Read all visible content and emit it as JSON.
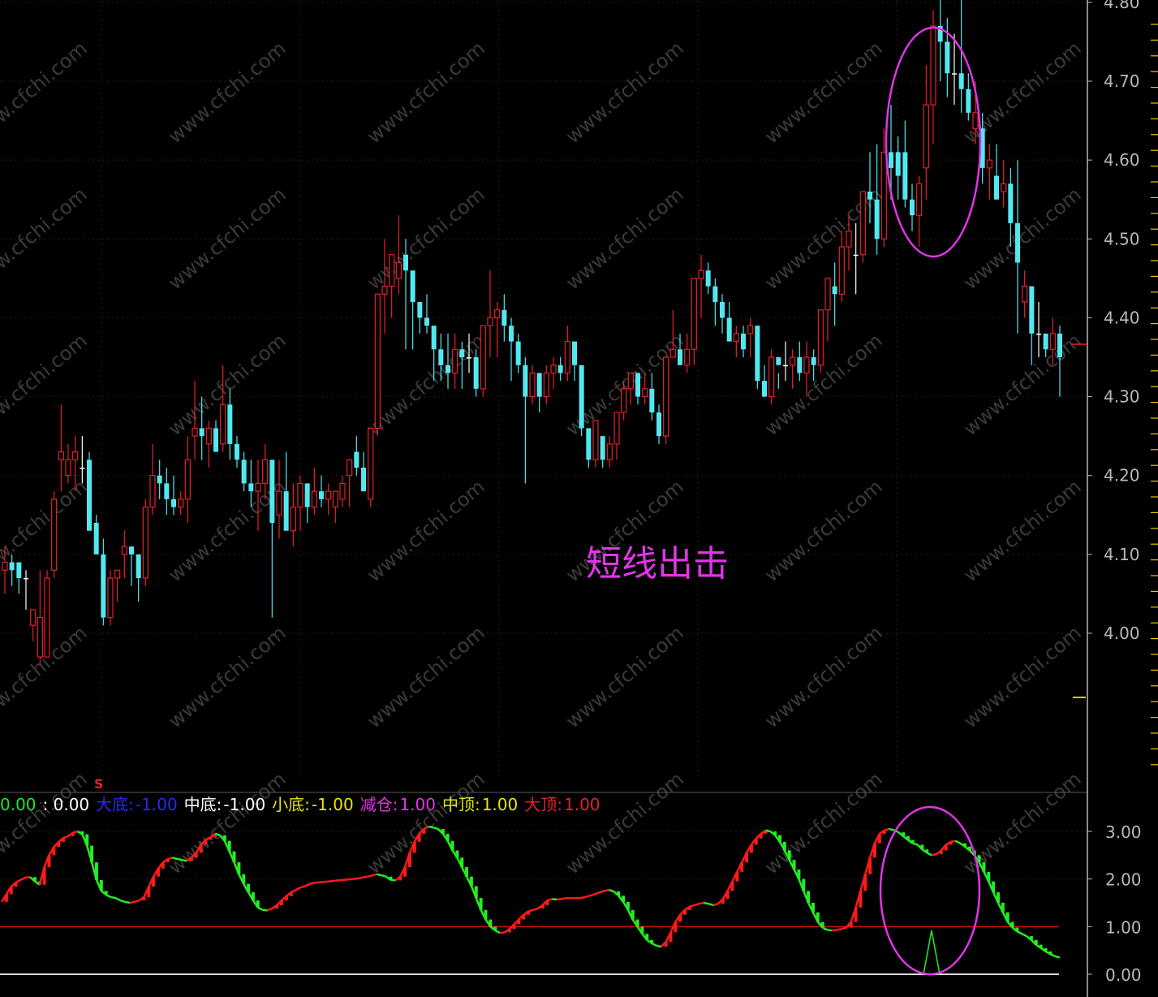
{
  "price_axis": [
    "4.80",
    "4.70",
    "4.60",
    "4.50",
    "4.40",
    "4.30",
    "4.20",
    "4.10",
    "4.00"
  ],
  "indicator_axis": [
    "3.00",
    "2.00",
    "1.00",
    "0.00"
  ],
  "watermark": "www.cfchi.com",
  "annotation": "短线出击",
  "signal_mark": "S",
  "indicator_legend": [
    {
      "text": "0.00",
      "color": "#1ee81e"
    },
    {
      "text": ": 0.00",
      "color": "#ffffff"
    },
    {
      "text": "大底:",
      "color": "#2828ff"
    },
    {
      "text": "-1.00",
      "color": "#2828ff"
    },
    {
      "text": "中底:",
      "color": "#ffffff"
    },
    {
      "text": "-1.00",
      "color": "#ffffff"
    },
    {
      "text": "小底:",
      "color": "#e6e600"
    },
    {
      "text": "-1.00",
      "color": "#e6e600"
    },
    {
      "text": "减仓:",
      "color": "#e035e6"
    },
    {
      "text": "1.00",
      "color": "#e035e6"
    },
    {
      "text": "中顶:",
      "color": "#e6e600"
    },
    {
      "text": "1.00",
      "color": "#e6e600"
    },
    {
      "text": "大顶:",
      "color": "#e8202a"
    },
    {
      "text": "1.00",
      "color": "#e8202a"
    }
  ],
  "colors": {
    "up": "#e8202a",
    "down": "#52e8f0",
    "doji": "#ffffff",
    "ind_up": "#ff1a1a",
    "ind_down": "#22ee22",
    "circle": "#e035e6",
    "axis": "#b8b8b8",
    "ref_line": "#d01010",
    "yellow": "#e6c800"
  },
  "chart_data": [
    {
      "type": "candlestick",
      "title": "",
      "y_ticks": [
        4.0,
        4.1,
        4.2,
        4.3,
        4.4,
        4.5,
        4.6,
        4.7,
        4.8
      ],
      "ylim": [
        3.92,
        4.81
      ],
      "grid": true,
      "ohlc": [
        [
          4.08,
          4.11,
          4.05,
          4.09
        ],
        [
          4.09,
          4.1,
          4.06,
          4.08
        ],
        [
          4.09,
          4.08,
          4.05,
          4.07
        ],
        [
          4.07,
          4.08,
          4.03,
          4.07
        ],
        [
          4.01,
          4.03,
          3.99,
          4.03
        ],
        [
          3.97,
          4.08,
          3.96,
          4.02
        ],
        [
          3.97,
          4.08,
          3.97,
          4.07
        ],
        [
          4.08,
          4.18,
          4.07,
          4.17
        ],
        [
          4.22,
          4.29,
          4.18,
          4.23
        ],
        [
          4.2,
          4.24,
          4.19,
          4.22
        ],
        [
          4.22,
          4.25,
          4.18,
          4.23
        ],
        [
          4.21,
          4.25,
          4.19,
          4.21
        ],
        [
          4.22,
          4.23,
          4.15,
          4.13
        ],
        [
          4.14,
          4.15,
          4.1,
          4.1
        ],
        [
          4.1,
          4.12,
          4.01,
          4.02
        ],
        [
          4.02,
          4.08,
          4.01,
          4.07
        ],
        [
          4.07,
          4.08,
          4.04,
          4.08
        ],
        [
          4.1,
          4.13,
          4.07,
          4.11
        ],
        [
          4.11,
          4.1,
          4.06,
          4.1
        ],
        [
          4.1,
          4.1,
          4.04,
          4.07
        ],
        [
          4.07,
          4.17,
          4.06,
          4.16
        ],
        [
          4.16,
          4.24,
          4.15,
          4.2
        ],
        [
          4.2,
          4.22,
          4.17,
          4.19
        ],
        [
          4.19,
          4.21,
          4.15,
          4.17
        ],
        [
          4.17,
          4.2,
          4.15,
          4.16
        ],
        [
          4.16,
          4.18,
          4.15,
          4.17
        ],
        [
          4.17,
          4.25,
          4.14,
          4.22
        ],
        [
          4.25,
          4.32,
          4.22,
          4.26
        ],
        [
          4.26,
          4.3,
          4.22,
          4.25
        ],
        [
          4.24,
          4.27,
          4.21,
          4.26
        ],
        [
          4.26,
          4.27,
          4.23,
          4.23
        ],
        [
          4.24,
          4.34,
          4.23,
          4.29
        ],
        [
          4.29,
          4.31,
          4.22,
          4.24
        ],
        [
          4.24,
          4.25,
          4.21,
          4.22
        ],
        [
          4.22,
          4.23,
          4.18,
          4.19
        ],
        [
          4.19,
          4.22,
          4.16,
          4.18
        ],
        [
          4.18,
          4.22,
          4.13,
          4.19
        ],
        [
          4.19,
          4.24,
          4.17,
          4.22
        ],
        [
          4.22,
          4.2,
          4.02,
          4.14
        ],
        [
          4.15,
          4.22,
          4.12,
          4.18
        ],
        [
          4.18,
          4.23,
          4.14,
          4.13
        ],
        [
          4.13,
          4.19,
          4.11,
          4.16
        ],
        [
          4.16,
          4.2,
          4.13,
          4.19
        ],
        [
          4.19,
          4.19,
          4.14,
          4.16
        ],
        [
          4.16,
          4.21,
          4.15,
          4.18
        ],
        [
          4.18,
          4.2,
          4.16,
          4.17
        ],
        [
          4.17,
          4.19,
          4.15,
          4.18
        ],
        [
          4.16,
          4.18,
          4.14,
          4.18
        ],
        [
          4.17,
          4.2,
          4.16,
          4.19
        ],
        [
          4.2,
          4.22,
          4.16,
          4.22
        ],
        [
          4.23,
          4.25,
          4.2,
          4.21
        ],
        [
          4.21,
          4.23,
          4.18,
          4.18
        ],
        [
          4.17,
          4.26,
          4.16,
          4.26
        ],
        [
          4.26,
          4.42,
          4.25,
          4.43
        ],
        [
          4.43,
          4.5,
          4.38,
          4.44
        ],
        [
          4.44,
          4.48,
          4.4,
          4.48
        ],
        [
          4.45,
          4.53,
          4.43,
          4.47
        ],
        [
          4.48,
          4.5,
          4.36,
          4.46
        ],
        [
          4.46,
          4.45,
          4.36,
          4.42
        ],
        [
          4.42,
          4.42,
          4.38,
          4.4
        ],
        [
          4.4,
          4.43,
          4.38,
          4.39
        ],
        [
          4.39,
          4.38,
          4.32,
          4.36
        ],
        [
          4.36,
          4.38,
          4.32,
          4.34
        ],
        [
          4.34,
          4.38,
          4.31,
          4.33
        ],
        [
          4.33,
          4.38,
          4.31,
          4.36
        ],
        [
          4.36,
          4.37,
          4.31,
          4.35
        ],
        [
          4.35,
          4.38,
          4.33,
          4.35
        ],
        [
          4.35,
          4.36,
          4.3,
          4.31
        ],
        [
          4.31,
          4.39,
          4.3,
          4.39
        ],
        [
          4.39,
          4.46,
          4.35,
          4.4
        ],
        [
          4.4,
          4.42,
          4.35,
          4.41
        ],
        [
          4.41,
          4.43,
          4.37,
          4.39
        ],
        [
          4.39,
          4.4,
          4.32,
          4.37
        ],
        [
          4.37,
          4.38,
          4.33,
          4.34
        ],
        [
          4.34,
          4.35,
          4.19,
          4.3
        ],
        [
          4.3,
          4.34,
          4.29,
          4.33
        ],
        [
          4.33,
          4.31,
          4.28,
          4.3
        ],
        [
          4.3,
          4.34,
          4.29,
          4.33
        ],
        [
          4.33,
          4.35,
          4.31,
          4.34
        ],
        [
          4.34,
          4.35,
          4.32,
          4.33
        ],
        [
          4.33,
          4.39,
          4.32,
          4.37
        ],
        [
          4.37,
          4.36,
          4.32,
          4.34
        ],
        [
          4.34,
          4.31,
          4.25,
          4.26
        ],
        [
          4.26,
          4.24,
          4.21,
          4.22
        ],
        [
          4.22,
          4.26,
          4.21,
          4.27
        ],
        [
          4.25,
          4.23,
          4.21,
          4.22
        ],
        [
          4.22,
          4.25,
          4.21,
          4.24
        ],
        [
          4.24,
          4.28,
          4.22,
          4.28
        ],
        [
          4.28,
          4.32,
          4.27,
          4.31
        ],
        [
          4.31,
          4.33,
          4.29,
          4.33
        ],
        [
          4.33,
          4.33,
          4.29,
          4.3
        ],
        [
          4.3,
          4.33,
          4.29,
          4.31
        ],
        [
          4.31,
          4.33,
          4.27,
          4.28
        ],
        [
          4.28,
          4.29,
          4.24,
          4.25
        ],
        [
          4.25,
          4.34,
          4.24,
          4.35
        ],
        [
          4.35,
          4.41,
          4.35,
          4.36
        ],
        [
          4.36,
          4.38,
          4.34,
          4.34
        ],
        [
          4.34,
          4.38,
          4.33,
          4.36
        ],
        [
          4.36,
          4.42,
          4.34,
          4.45
        ],
        [
          4.45,
          4.48,
          4.4,
          4.46
        ],
        [
          4.46,
          4.47,
          4.43,
          4.44
        ],
        [
          4.44,
          4.45,
          4.39,
          4.42
        ],
        [
          4.42,
          4.43,
          4.38,
          4.4
        ],
        [
          4.4,
          4.42,
          4.37,
          4.37
        ],
        [
          4.37,
          4.39,
          4.35,
          4.38
        ],
        [
          4.38,
          4.39,
          4.35,
          4.36
        ],
        [
          4.38,
          4.4,
          4.35,
          4.39
        ],
        [
          4.39,
          4.38,
          4.31,
          4.32
        ],
        [
          4.32,
          4.34,
          4.3,
          4.3
        ],
        [
          4.3,
          4.36,
          4.29,
          4.35
        ],
        [
          4.35,
          4.33,
          4.31,
          4.34
        ],
        [
          4.34,
          4.37,
          4.32,
          4.34
        ],
        [
          4.34,
          4.36,
          4.31,
          4.35
        ],
        [
          4.35,
          4.37,
          4.32,
          4.33
        ],
        [
          4.33,
          4.37,
          4.3,
          4.35
        ],
        [
          4.35,
          4.36,
          4.32,
          4.34
        ],
        [
          4.34,
          4.41,
          4.33,
          4.41
        ],
        [
          4.41,
          4.45,
          4.37,
          4.45
        ],
        [
          4.44,
          4.47,
          4.39,
          4.43
        ],
        [
          4.43,
          4.51,
          4.42,
          4.49
        ],
        [
          4.49,
          4.53,
          4.46,
          4.51
        ],
        [
          4.48,
          4.52,
          4.43,
          4.48
        ],
        [
          4.48,
          4.56,
          4.47,
          4.56
        ],
        [
          4.56,
          4.61,
          4.52,
          4.55
        ],
        [
          4.55,
          4.62,
          4.48,
          4.5
        ],
        [
          4.5,
          4.64,
          4.49,
          4.61
        ],
        [
          4.61,
          4.67,
          4.55,
          4.59
        ],
        [
          4.61,
          4.63,
          4.55,
          4.58
        ],
        [
          4.61,
          4.65,
          4.54,
          4.55
        ],
        [
          4.55,
          4.57,
          4.51,
          4.53
        ],
        [
          4.53,
          4.58,
          4.49,
          4.57
        ],
        [
          4.59,
          4.72,
          4.55,
          4.67
        ],
        [
          4.67,
          4.79,
          4.62,
          4.77
        ],
        [
          4.77,
          4.82,
          4.7,
          4.75
        ],
        [
          4.75,
          4.78,
          4.68,
          4.71
        ],
        [
          4.71,
          4.76,
          4.67,
          4.71
        ],
        [
          4.71,
          4.81,
          4.66,
          4.69
        ],
        [
          4.69,
          4.71,
          4.65,
          4.66
        ],
        [
          4.64,
          4.7,
          4.62,
          4.66
        ],
        [
          4.64,
          4.66,
          4.57,
          4.59
        ],
        [
          4.59,
          4.62,
          4.55,
          4.6
        ],
        [
          4.58,
          4.62,
          4.55,
          4.55
        ],
        [
          4.56,
          4.6,
          4.54,
          4.57
        ],
        [
          4.57,
          4.59,
          4.49,
          4.52
        ],
        [
          4.52,
          4.6,
          4.38,
          4.47
        ],
        [
          4.42,
          4.46,
          4.4,
          4.44
        ],
        [
          4.44,
          4.43,
          4.34,
          4.38
        ],
        [
          4.38,
          4.42,
          4.35,
          4.38
        ],
        [
          4.38,
          4.38,
          4.35,
          4.36
        ],
        [
          4.36,
          4.4,
          4.34,
          4.38
        ],
        [
          4.38,
          4.39,
          4.3,
          4.35
        ]
      ]
    },
    {
      "type": "indicator",
      "title": "",
      "y_ticks": [
        0.0,
        1.0,
        2.0,
        3.0
      ],
      "ylim": [
        0.0,
        3.3
      ],
      "reference_line": 1.0,
      "series": [
        {
          "values": [
            1.52,
            1.68,
            1.84,
            1.93,
            1.98,
            2.03,
            2.04,
            1.95,
            1.88,
            2.25,
            2.5,
            2.67,
            2.78,
            2.86,
            2.9,
            2.97,
            3.0,
            2.94,
            2.7,
            2.35,
            1.98,
            1.75,
            1.67,
            1.62,
            1.6,
            1.55,
            1.52,
            1.5,
            1.52,
            1.55,
            1.62,
            1.84,
            2.05,
            2.22,
            2.35,
            2.42,
            2.45,
            2.42,
            2.4,
            2.38,
            2.45,
            2.55,
            2.72,
            2.82,
            2.88,
            2.95,
            2.92,
            2.8,
            2.58,
            2.35,
            2.1,
            1.9,
            1.72,
            1.55,
            1.4,
            1.35,
            1.34,
            1.38,
            1.45,
            1.55,
            1.64,
            1.72,
            1.77,
            1.82,
            1.85,
            1.9,
            1.92,
            1.93,
            1.94,
            1.95,
            1.96,
            1.97,
            1.98,
            1.99,
            2.0,
            2.01,
            2.03,
            2.05,
            2.07,
            2.1,
            2.08,
            2.05,
            1.98,
            1.97,
            2.05,
            2.25,
            2.55,
            2.78,
            2.95,
            3.05,
            3.1,
            3.08,
            3.05,
            2.95,
            2.8,
            2.6,
            2.45,
            2.25,
            2.05,
            1.85,
            1.6,
            1.35,
            1.15,
            1.0,
            0.92,
            0.87,
            0.88,
            0.95,
            1.05,
            1.15,
            1.25,
            1.32,
            1.35,
            1.38,
            1.45,
            1.55,
            1.58,
            1.57,
            1.58,
            1.6,
            1.6,
            1.6,
            1.6,
            1.62,
            1.65,
            1.68,
            1.72,
            1.75,
            1.77,
            1.74,
            1.65,
            1.52,
            1.35,
            1.15,
            1.0,
            0.85,
            0.72,
            0.65,
            0.6,
            0.58,
            0.68,
            0.88,
            1.1,
            1.25,
            1.35,
            1.42,
            1.45,
            1.48,
            1.5,
            1.48,
            1.45,
            1.48,
            1.58,
            1.75,
            1.95,
            2.15,
            2.35,
            2.55,
            2.72,
            2.85,
            2.95,
            3.02,
            3.0,
            2.92,
            2.78,
            2.6,
            2.4,
            2.2,
            2.0,
            1.75,
            1.5,
            1.3,
            1.1,
            0.98,
            0.93,
            0.92,
            0.93,
            0.95,
            0.98,
            1.1,
            1.4,
            1.75,
            2.1,
            2.45,
            2.75,
            2.95,
            3.02,
            3.05,
            3.03,
            2.98,
            2.9,
            2.82,
            2.75,
            2.72,
            2.62,
            2.55,
            2.5,
            2.52,
            2.6,
            2.72,
            2.78,
            2.8,
            2.75,
            2.68,
            2.6,
            2.5,
            2.35,
            2.15,
            1.95,
            1.72,
            1.5,
            1.3,
            1.1,
            0.98,
            0.9,
            0.85,
            0.8,
            0.72,
            0.62,
            0.55,
            0.48,
            0.42,
            0.38,
            0.35
          ]
        }
      ]
    }
  ]
}
